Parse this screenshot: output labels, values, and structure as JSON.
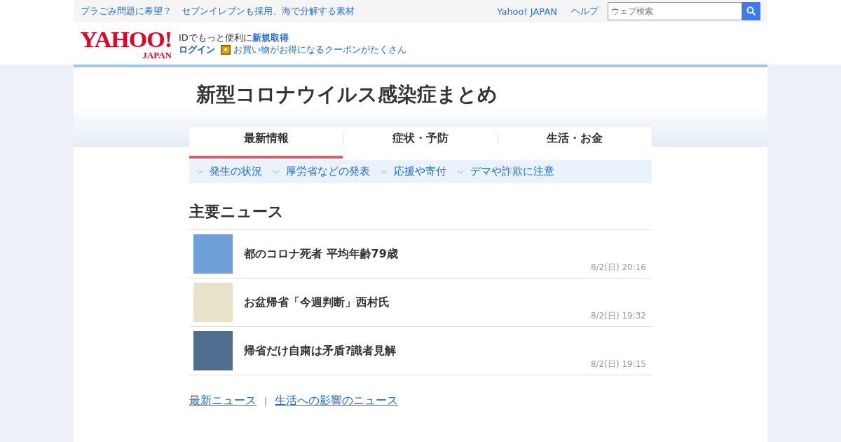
{
  "top_bar": {
    "left_links": [
      "プラごみ問題に希望？",
      "セブンイレブンも採用、海で分解する素材"
    ],
    "right_links": [
      "Yahoo! JAPAN",
      "ヘルプ"
    ],
    "search": {
      "placeholder": "ウェブ検索"
    }
  },
  "header": {
    "logo": {
      "main": "YAHOO!",
      "sub": "JAPAN"
    },
    "id_text": "IDでもっと便利に",
    "signup_link": "新規取得",
    "login_link": "ログイン",
    "coupon_link": "お買い物がお得になるクーポンがたくさん"
  },
  "page_title": "新型コロナウイルス感染症まとめ",
  "tabs": [
    {
      "label": "最新情報",
      "selected": true
    },
    {
      "label": "症状・予防",
      "selected": false
    },
    {
      "label": "生活・お金",
      "selected": false
    }
  ],
  "sub_nav": [
    "発生の状況",
    "厚労省などの発表",
    "応援や寄付",
    "デマや詐欺に注意"
  ],
  "section_heading": "主要ニュース",
  "news": [
    {
      "title": "都のコロナ死者 平均年齢79歳",
      "time": "8/2(日) 20:16",
      "kind": "building"
    },
    {
      "title": "お盆帰省「今週判断」西村氏",
      "time": "8/2(日) 19:32",
      "kind": "portrait"
    },
    {
      "title": "帰省だけ自粛は矛盾?識者見解",
      "time": "8/2(日) 19:15",
      "kind": "press"
    }
  ],
  "footer_links": [
    {
      "label": "最新ニュース"
    },
    {
      "label": "生活への影響のニュース"
    }
  ],
  "footer_separator": "｜"
}
